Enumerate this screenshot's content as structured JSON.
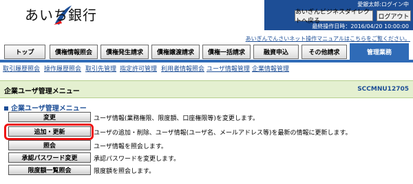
{
  "brand": {
    "name": "あいち銀行",
    "colors": {
      "primary": "#1d4e96",
      "accent": "#2f6bb7",
      "highlight": "#e11111"
    }
  },
  "header": {
    "user": "愛銀太郎:ログイン中",
    "business_direct_button": "あいぎんビジネスダイレクトへ戻る",
    "logout_button": "ログアウト",
    "last_operation": "最終操作日時：2016/04/20 10:00:00",
    "manual_link": "あいぎんでんさいネット操作マニュアルはこちらをご覧ください。"
  },
  "tabs": [
    "トップ",
    "債権情報照会",
    "債権発生請求",
    "債権譲渡請求",
    "債権一括請求",
    "融資申込",
    "その他請求",
    "管理業務"
  ],
  "sublinks": [
    "取引履歴照会",
    "操作履歴照会",
    "取引先管理",
    "指定許可管理",
    "利用者情報照会",
    "ユーザ情報管理",
    "企業情報管理"
  ],
  "page": {
    "title": "企業ユーザ管理メニュー",
    "screen_id": "SCCMNU12705",
    "section": "企業ユーザ管理メニュー"
  },
  "menu": [
    {
      "label": "変更",
      "desc": "ユーザ情報(業務権限、限度額、口座権限等)を変更します。"
    },
    {
      "label": "追加・更新",
      "desc": "ユーザの追加・削除、ユーザ情報(ユーザ名、メールアドレス等)を最新の情報に更新します。"
    },
    {
      "label": "照会",
      "desc": "ユーザ情報を照会します。"
    },
    {
      "label": "承認パスワード変更",
      "desc": "承認パスワードを変更します。"
    },
    {
      "label": "限度額一覧照会",
      "desc": "限度額を照会します。"
    }
  ]
}
